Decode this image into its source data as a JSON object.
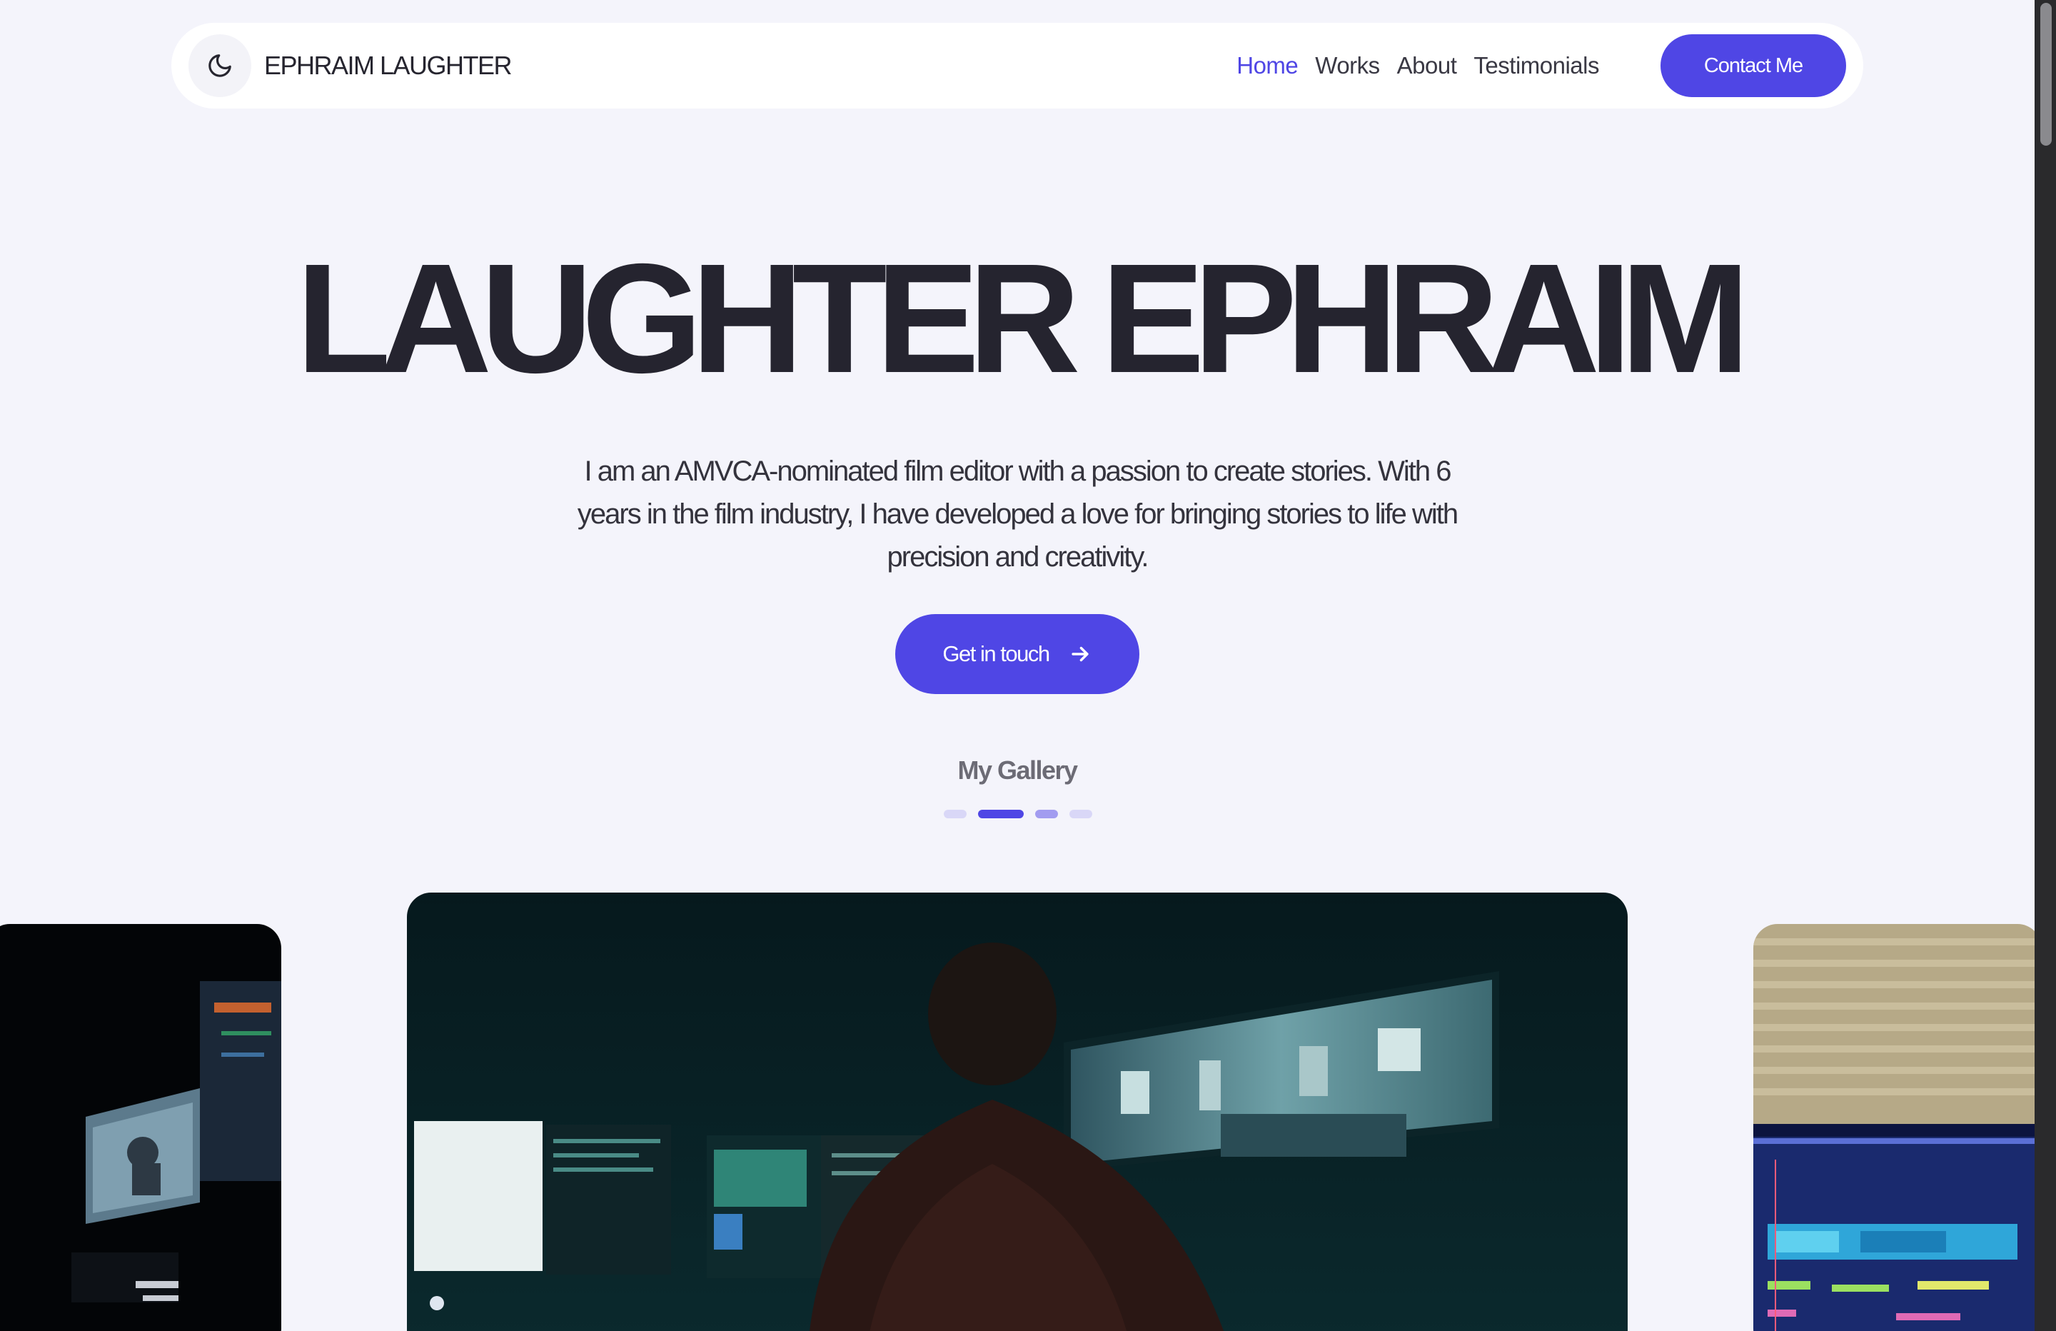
{
  "nav": {
    "brand": "EPHRAIM LAUGHTER",
    "theme_icon": "moon-icon",
    "links": [
      {
        "label": "Home",
        "active": true
      },
      {
        "label": "Works",
        "active": false
      },
      {
        "label": "About",
        "active": false
      },
      {
        "label": "Testimonials",
        "active": false
      }
    ],
    "contact_label": "Contact Me"
  },
  "hero": {
    "title": "LAUGHTER EPHRAIM",
    "description": "I am an AMVCA-nominated film editor with a passion to create stories. With 6 years in the film industry, I have developed a love for bringing stories to life with precision and creativity.",
    "cta_label": "Get in touch",
    "cta_icon": "arrow-right-icon"
  },
  "gallery": {
    "title": "My Gallery",
    "dots": [
      {
        "active": false
      },
      {
        "active": true
      },
      {
        "active": false
      },
      {
        "active": false
      }
    ],
    "slides": [
      {
        "name": "editing-suite-side"
      },
      {
        "name": "editor-at-workstation"
      },
      {
        "name": "daw-timeline-screen"
      }
    ]
  },
  "colors": {
    "accent": "#4f46e5",
    "background": "#f4f4fb",
    "text": "#26252f"
  }
}
